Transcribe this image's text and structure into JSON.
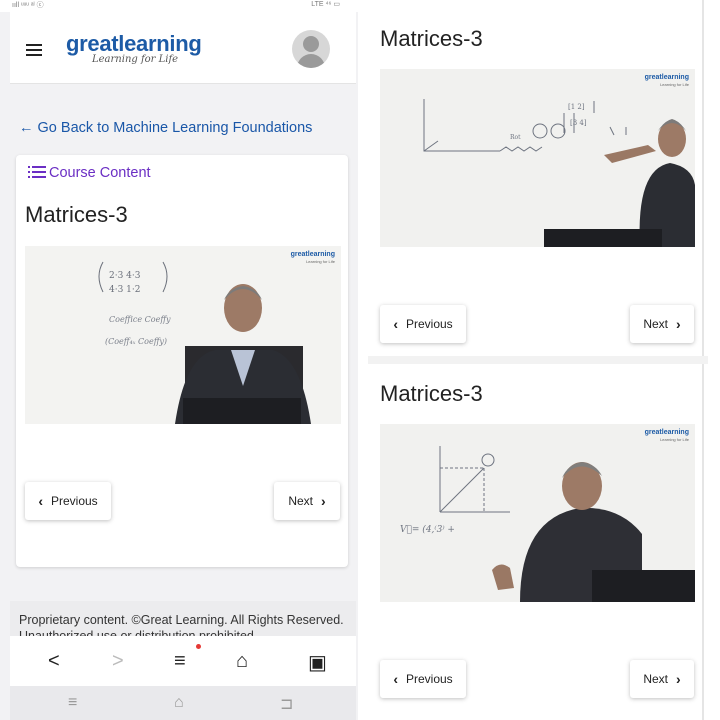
{
  "status": {
    "left": "ııll ᵘᵘᵘ ᵃˡ ⓒ",
    "right": "LTE ⁴⁶ ▭"
  },
  "header": {
    "brand": "greatlearning",
    "brand_great": "great",
    "brand_learning": "learning",
    "tagline": "Learning for Life"
  },
  "back_link": "← Go Back to Machine Learning Foundations",
  "course_content_label": "Course Content",
  "lesson_title": "Matrices-3",
  "video_watermark": "greatlearning",
  "whiteboard": {
    "m1": "2·3    4·3",
    "m2": "4·3    1·2",
    "l1": "Coeffice  Coeffy",
    "l2": "Coeff₄ₓ  Coeffy",
    "vec": "V⃗= (4,⁽3⁾ +"
  },
  "buttons": {
    "previous": "Previous",
    "next": "Next"
  },
  "footer_text": "Proprietary content. ©Great Learning. All Rights Reserved. Unauthorized use or distribution prohibited.",
  "browser_nav": {
    "back": "<",
    "forward": ">",
    "menu": "≡",
    "home": "⌂",
    "tabs": "▣"
  },
  "system_nav": {
    "menu": "≡",
    "home": "⌂",
    "back": "⊐"
  },
  "colors": {
    "brand_blue": "#1d5ba6",
    "link_blue": "#1a57a8",
    "purple": "#6b2fc4"
  }
}
